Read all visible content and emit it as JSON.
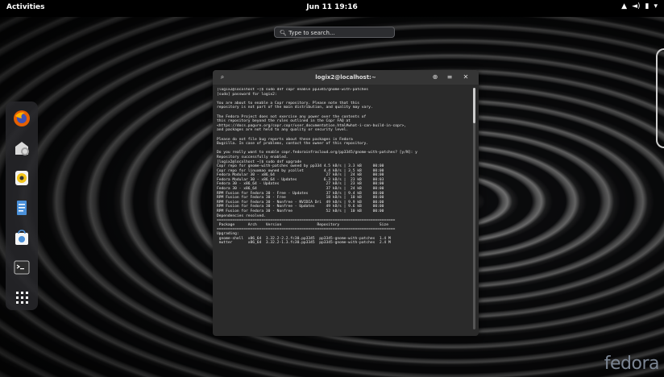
{
  "topbar": {
    "activities": "Activities",
    "clock": "Jun 11  19:16",
    "tray_wifi": "▲",
    "tray_volume": "◄)",
    "tray_battery": "▮",
    "tray_menu": "▾"
  },
  "search": {
    "placeholder": "Type to search..."
  },
  "dock": {
    "items": [
      {
        "icon": "firefox-icon",
        "color": "#e66000"
      },
      {
        "icon": "files-icon",
        "color": "#d9d9d9"
      },
      {
        "icon": "rhythmbox-icon",
        "color": "#f2d04a"
      },
      {
        "icon": "document-icon",
        "color": "#4a90d9"
      },
      {
        "icon": "software-icon",
        "color": "#4a90d9"
      },
      {
        "icon": "terminal-icon",
        "color": "#3b3b3b"
      },
      {
        "icon": "show-apps-icon",
        "color": "#ffffff"
      }
    ]
  },
  "terminal": {
    "title": "logix2@localhost:~",
    "lines": [
      "[logix2@localhost ~]$ sudo dnf copr enable pp3345/gnome-with-patches",
      "[sudo] password for logix2:",
      "",
      "You are about to enable a Copr repository. Please note that this",
      "repository is not part of the main distribution, and quality may vary.",
      "",
      "The Fedora Project does not exercise any power over the contents of",
      "this repository beyond the rules outlined in the Copr FAQ at",
      "<https://docs.pagure.org/copr.copr/user_documentation.html#what-i-can-build-in-copr>,",
      "and packages are not held to any quality or security level.",
      "",
      "Please do not file bug reports about these packages in Fedora",
      "Bugzilla. In case of problems, contact the owner of this repository.",
      "",
      "Do you really want to enable copr.fedorainfracloud.org/pp3345/gnome-with-patches? [y/N]: y",
      "Repository successfully enabled.",
      "[logix2@localhost ~]$ sudo dnf upgrade",
      "Copr repo for gnome-with-patches owned by pp334 4.5 kB/s | 3.3 kB     00:00",
      "Copr repo for linuxmao owned by ycollet         4.4 kB/s | 3.5 kB     00:00",
      "Fedora Modular 30 - x86_64                       27 kB/s |  24 kB     00:00",
      "Fedora Modular 30 - x86_64 - Updates            6.3 kB/s |  23 kB     00:03",
      "Fedora 30 - x86_64 - Updates                     27 kB/s |  23 kB     00:00",
      "Fedora 30 - x86_64                               37 kB/s |  24 kB     00:00",
      "RPM Fusion for Fedora 30 - Free - Updates        37 kB/s | 9.4 kB     00:00",
      "RPM Fusion for Fedora 30 - Free                  18 kB/s |  10 kB     00:00",
      "RPM Fusion for Fedora 30 - Nonfree - NVIDIA Dri  49 kB/s | 9.9 kB     00:00",
      "RPM Fusion for Fedora 30 - Nonfree - Updates     49 kB/s | 9.6 kB     00:00",
      "RPM Fusion for Fedora 30 - Nonfree               52 kB/s |  10 kB     00:00",
      "Dependencies resolved.",
      "================================================================================",
      " Package      Arch    Version                Repository                  Size",
      "================================================================================",
      "Upgrading:",
      " gnome-shell  x86_64  3.32.2-2.2.fc30.pp3345  pp3345-gnome-with-patches  1.4 M",
      " mutter       x86_64  3.32.2-1.3.fc30.pp3345  pp3345-gnome-with-patches  2.4 M"
    ]
  },
  "wallpaper_brand": "fedora"
}
